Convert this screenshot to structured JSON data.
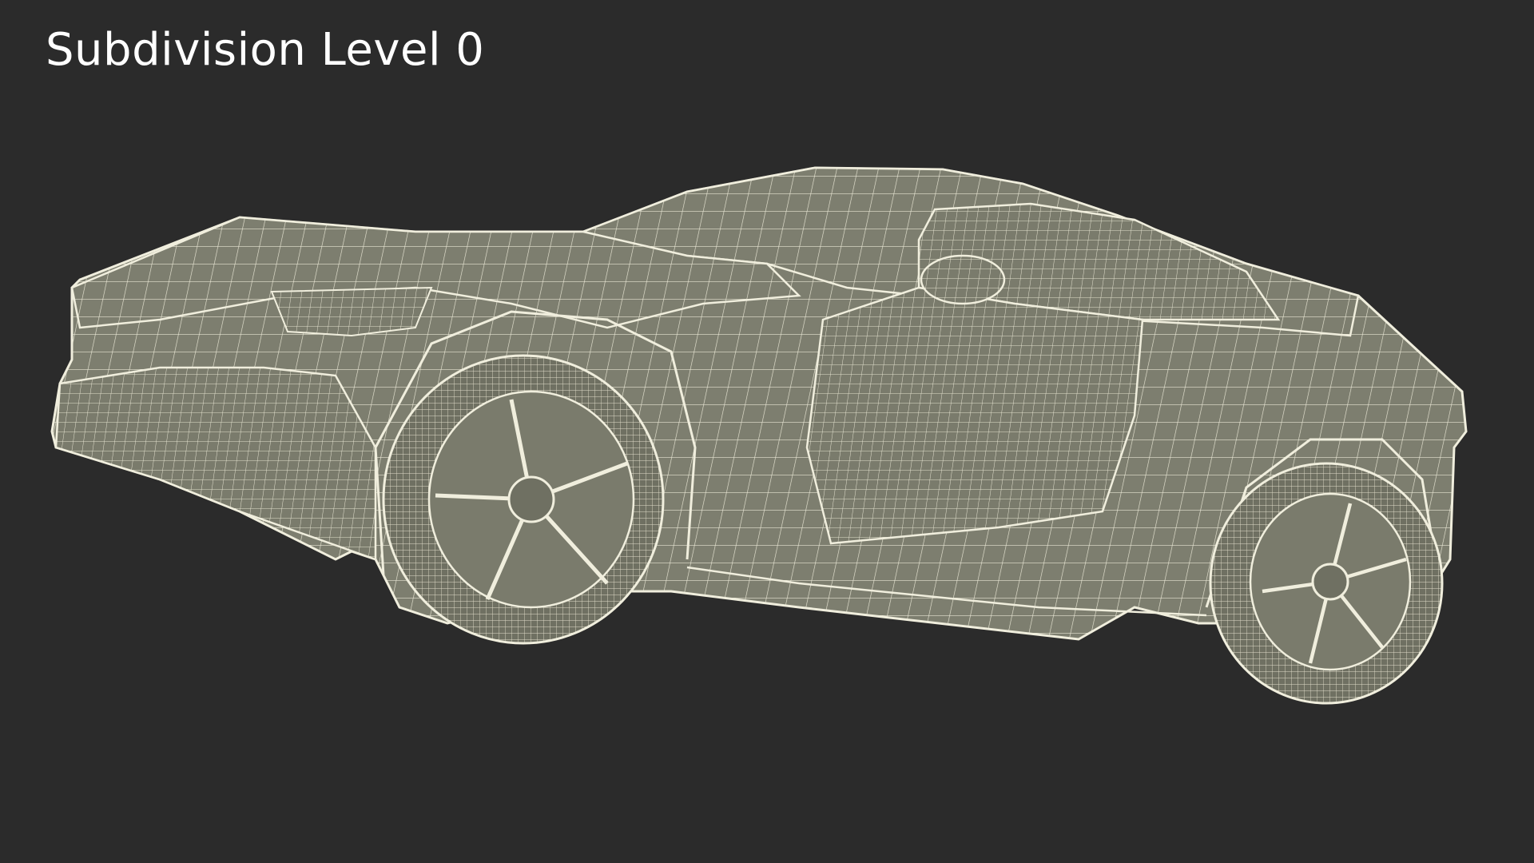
{
  "caption": "Subdivision Level 0",
  "colors": {
    "background": "#2b2b2b",
    "mesh_fill": "#7d7e6f",
    "mesh_wire": "#e8e6d4",
    "caption_text": "#ffffff"
  }
}
